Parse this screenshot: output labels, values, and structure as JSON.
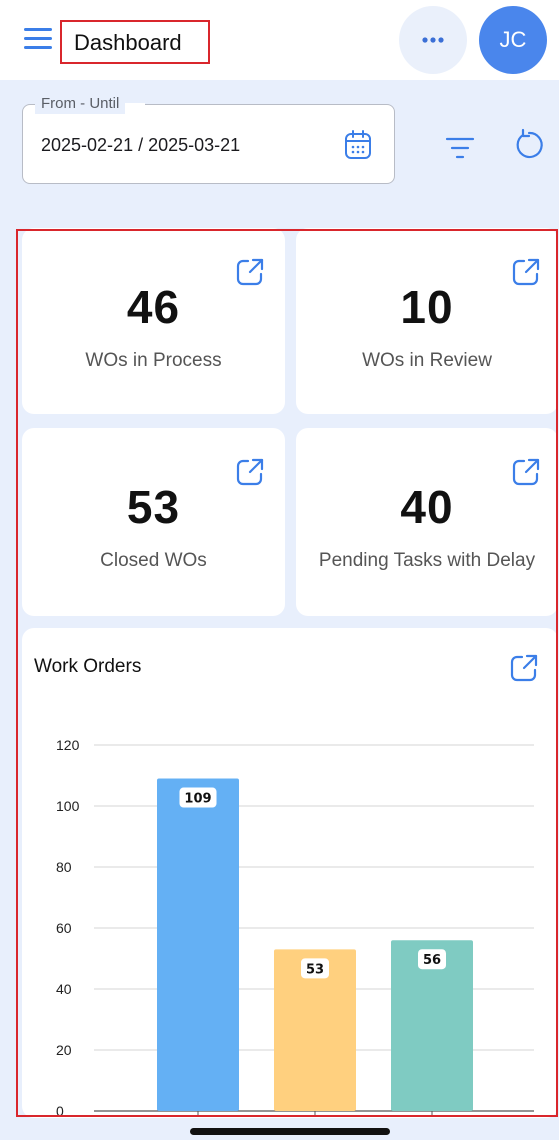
{
  "header": {
    "title": "Dashboard",
    "menu_icon": "hamburger-menu-icon",
    "more_icon": "more-horizontal-icon",
    "avatar_initials": "JC",
    "accent_color": "#4a86ec"
  },
  "filter": {
    "label": "From - Until",
    "value": "2025-02-21 / 2025-03-21",
    "calendar_icon": "calendar-icon",
    "filter_icon": "filter-icon",
    "refresh_icon": "refresh-icon"
  },
  "cards": [
    {
      "value": "46",
      "label": "WOs in Process",
      "icon": "external-link-icon"
    },
    {
      "value": "10",
      "label": "WOs in Review",
      "icon": "external-link-icon"
    },
    {
      "value": "53",
      "label": "Closed WOs",
      "icon": "external-link-icon"
    },
    {
      "value": "40",
      "label": "Pending Tasks with Delay",
      "icon": "external-link-icon"
    }
  ],
  "work_orders": {
    "title": "Work Orders",
    "icon": "external-link-icon"
  },
  "chart_data": {
    "type": "bar",
    "title": "Work Orders",
    "categories": [
      "",
      "",
      ""
    ],
    "values": [
      109,
      53,
      56
    ],
    "colors": [
      "#64b0f4",
      "#ffd07f",
      "#7fcbc2"
    ],
    "ylim": [
      0,
      120
    ],
    "yticks": [
      0,
      20,
      40,
      60,
      80,
      100,
      120
    ],
    "grid": true,
    "data_labels": [
      "109",
      "53",
      "56"
    ]
  }
}
